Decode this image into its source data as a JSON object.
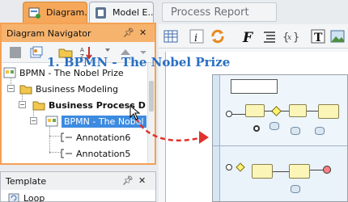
{
  "left_tabs": [
    {
      "label": "Diagram...",
      "icon": "diagram-icon",
      "active": true
    },
    {
      "label": "Model E...",
      "icon": "model-explorer-icon",
      "active": false
    }
  ],
  "navigator": {
    "title": "Diagram Navigator",
    "header_buttons": [
      "pin-icon",
      "close-icon"
    ],
    "toolbar_icons": [
      "stop-icon",
      "new-diagram-icon",
      "sort-icon",
      "up-arrow-icon"
    ],
    "tree": [
      {
        "label": "BPMN - The Nobel Prize",
        "icon": "bpmn-diagram-icon",
        "level": 0
      },
      {
        "label": "Business Modeling",
        "icon": "folder-icon",
        "level": 1
      },
      {
        "label": "Business Process D",
        "icon": "folder-icon",
        "level": 2,
        "bold": true
      },
      {
        "label": "BPMN - The Nobel",
        "icon": "bpmn-diagram-icon",
        "level": 3,
        "selected": true
      },
      {
        "label": "Annotation6",
        "icon": "annotation-icon",
        "level": 4
      },
      {
        "label": "Annotation5",
        "icon": "annotation-icon",
        "level": 4
      }
    ]
  },
  "template": {
    "title": "Template",
    "items": [
      {
        "label": "Loop",
        "icon": "loop-icon"
      }
    ]
  },
  "report": {
    "tab_label": "Process Report",
    "toolbar_icons": [
      "table-icon",
      "info-icon",
      "refresh-icon",
      "font-icon",
      "list-icon",
      "formula-icon",
      "text-icon",
      "image-icon"
    ],
    "title": "1. BPMN - The Nobel Prize"
  },
  "colors": {
    "accent_orange": "#f5a052",
    "selection_blue": "#3d8be0",
    "title_blue": "#2a6fc2",
    "arrow_red": "#e0322a"
  }
}
